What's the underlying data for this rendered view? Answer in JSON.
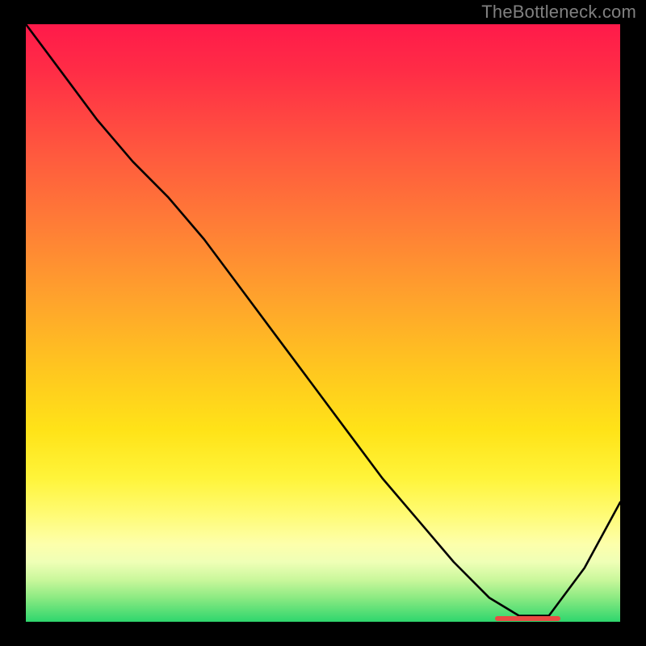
{
  "attribution": "TheBottleneck.com",
  "chart_data": {
    "type": "line",
    "title": "",
    "xlabel": "",
    "ylabel": "",
    "xlim": [
      0,
      100
    ],
    "ylim": [
      0,
      100
    ],
    "x": [
      0,
      6,
      12,
      18,
      24,
      30,
      36,
      42,
      48,
      54,
      60,
      66,
      72,
      78,
      83,
      88,
      94,
      100
    ],
    "values": [
      100,
      92,
      84,
      77,
      71,
      64,
      56,
      48,
      40,
      32,
      24,
      17,
      10,
      4,
      1,
      1,
      9,
      20
    ],
    "min_marker": {
      "x_start": 79,
      "x_end": 90,
      "y": 0.5
    },
    "background_gradient_stops": [
      {
        "pos": 0,
        "color": "#ff1a4a"
      },
      {
        "pos": 22,
        "color": "#ff5a3e"
      },
      {
        "pos": 46,
        "color": "#ffa32c"
      },
      {
        "pos": 68,
        "color": "#ffe318"
      },
      {
        "pos": 87,
        "color": "#fdffab"
      },
      {
        "pos": 100,
        "color": "#2ed66d"
      }
    ],
    "marker_color": "#e94a42"
  }
}
